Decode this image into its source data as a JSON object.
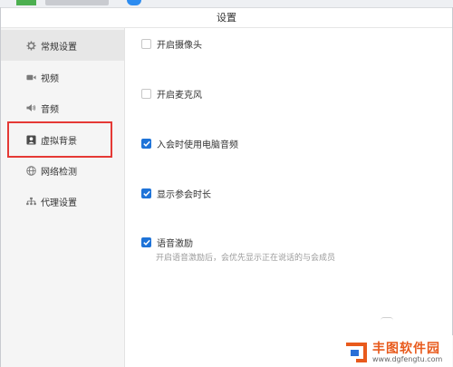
{
  "window": {
    "title": "设置"
  },
  "sidebar": {
    "items": [
      {
        "label": "常规设置",
        "icon": "gear-icon",
        "active": true
      },
      {
        "label": "视频",
        "icon": "camera-icon",
        "active": false
      },
      {
        "label": "音频",
        "icon": "speaker-icon",
        "active": false
      },
      {
        "label": "虚拟背景",
        "icon": "portrait-icon",
        "active": false,
        "highlighted": true
      },
      {
        "label": "网络检测",
        "icon": "globe-icon",
        "active": false
      },
      {
        "label": "代理设置",
        "icon": "network-icon",
        "active": false
      }
    ]
  },
  "settings": {
    "options": [
      {
        "label": "开启摄像头",
        "checked": false
      },
      {
        "label": "开启麦克风",
        "checked": false
      },
      {
        "label": "入会时使用电脑音频",
        "checked": true
      },
      {
        "label": "显示参会时长",
        "checked": true
      },
      {
        "label": "语音激励",
        "checked": true
      }
    ],
    "voice_hint": "开启语音激励后，会优先显示正在说话的与会成员"
  },
  "watermark": {
    "name": "丰图软件园",
    "url": "www.dgfengtu.com"
  },
  "colors": {
    "accent": "#1e73d8",
    "highlight": "#e53935",
    "sidebar_bg": "#f5f5f5",
    "active_item_bg": "#e7e7e7"
  }
}
